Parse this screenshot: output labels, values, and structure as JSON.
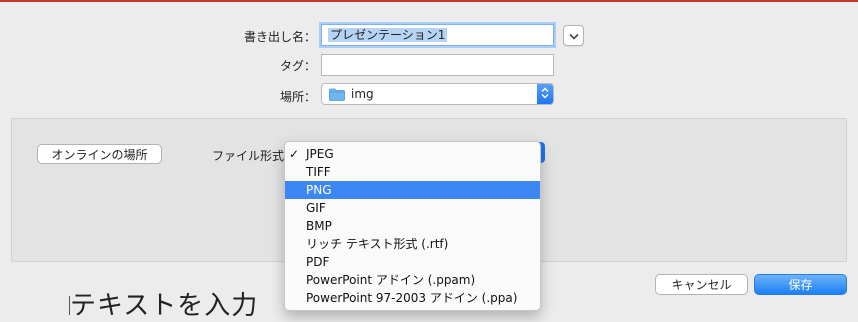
{
  "dialog": {
    "export_name_label": "書き出し名：",
    "export_name_value": "プレゼンテーション1",
    "tags_label": "タグ：",
    "tags_value": "",
    "where_label": "場所：",
    "where_value": "img",
    "online_locations_button": "オンラインの場所",
    "file_format_label": "ファイル形式",
    "cancel_button": "キャンセル",
    "save_button": "保存"
  },
  "format_menu": {
    "checked_item": "JPEG",
    "highlighted_item": "PNG",
    "items": [
      "JPEG",
      "TIFF",
      "PNG",
      "GIF",
      "BMP",
      "リッチ テキスト形式 (.rtf)",
      "PDF",
      "PowerPoint アドイン (.ppam)",
      "PowerPoint 97-2003 アドイン (.ppa)"
    ]
  },
  "background_document": {
    "text": "テキストを入力"
  },
  "colors": {
    "accent": "#3d87f5",
    "selection": "#b5d3f5",
    "panel": "#e3e3e3"
  }
}
